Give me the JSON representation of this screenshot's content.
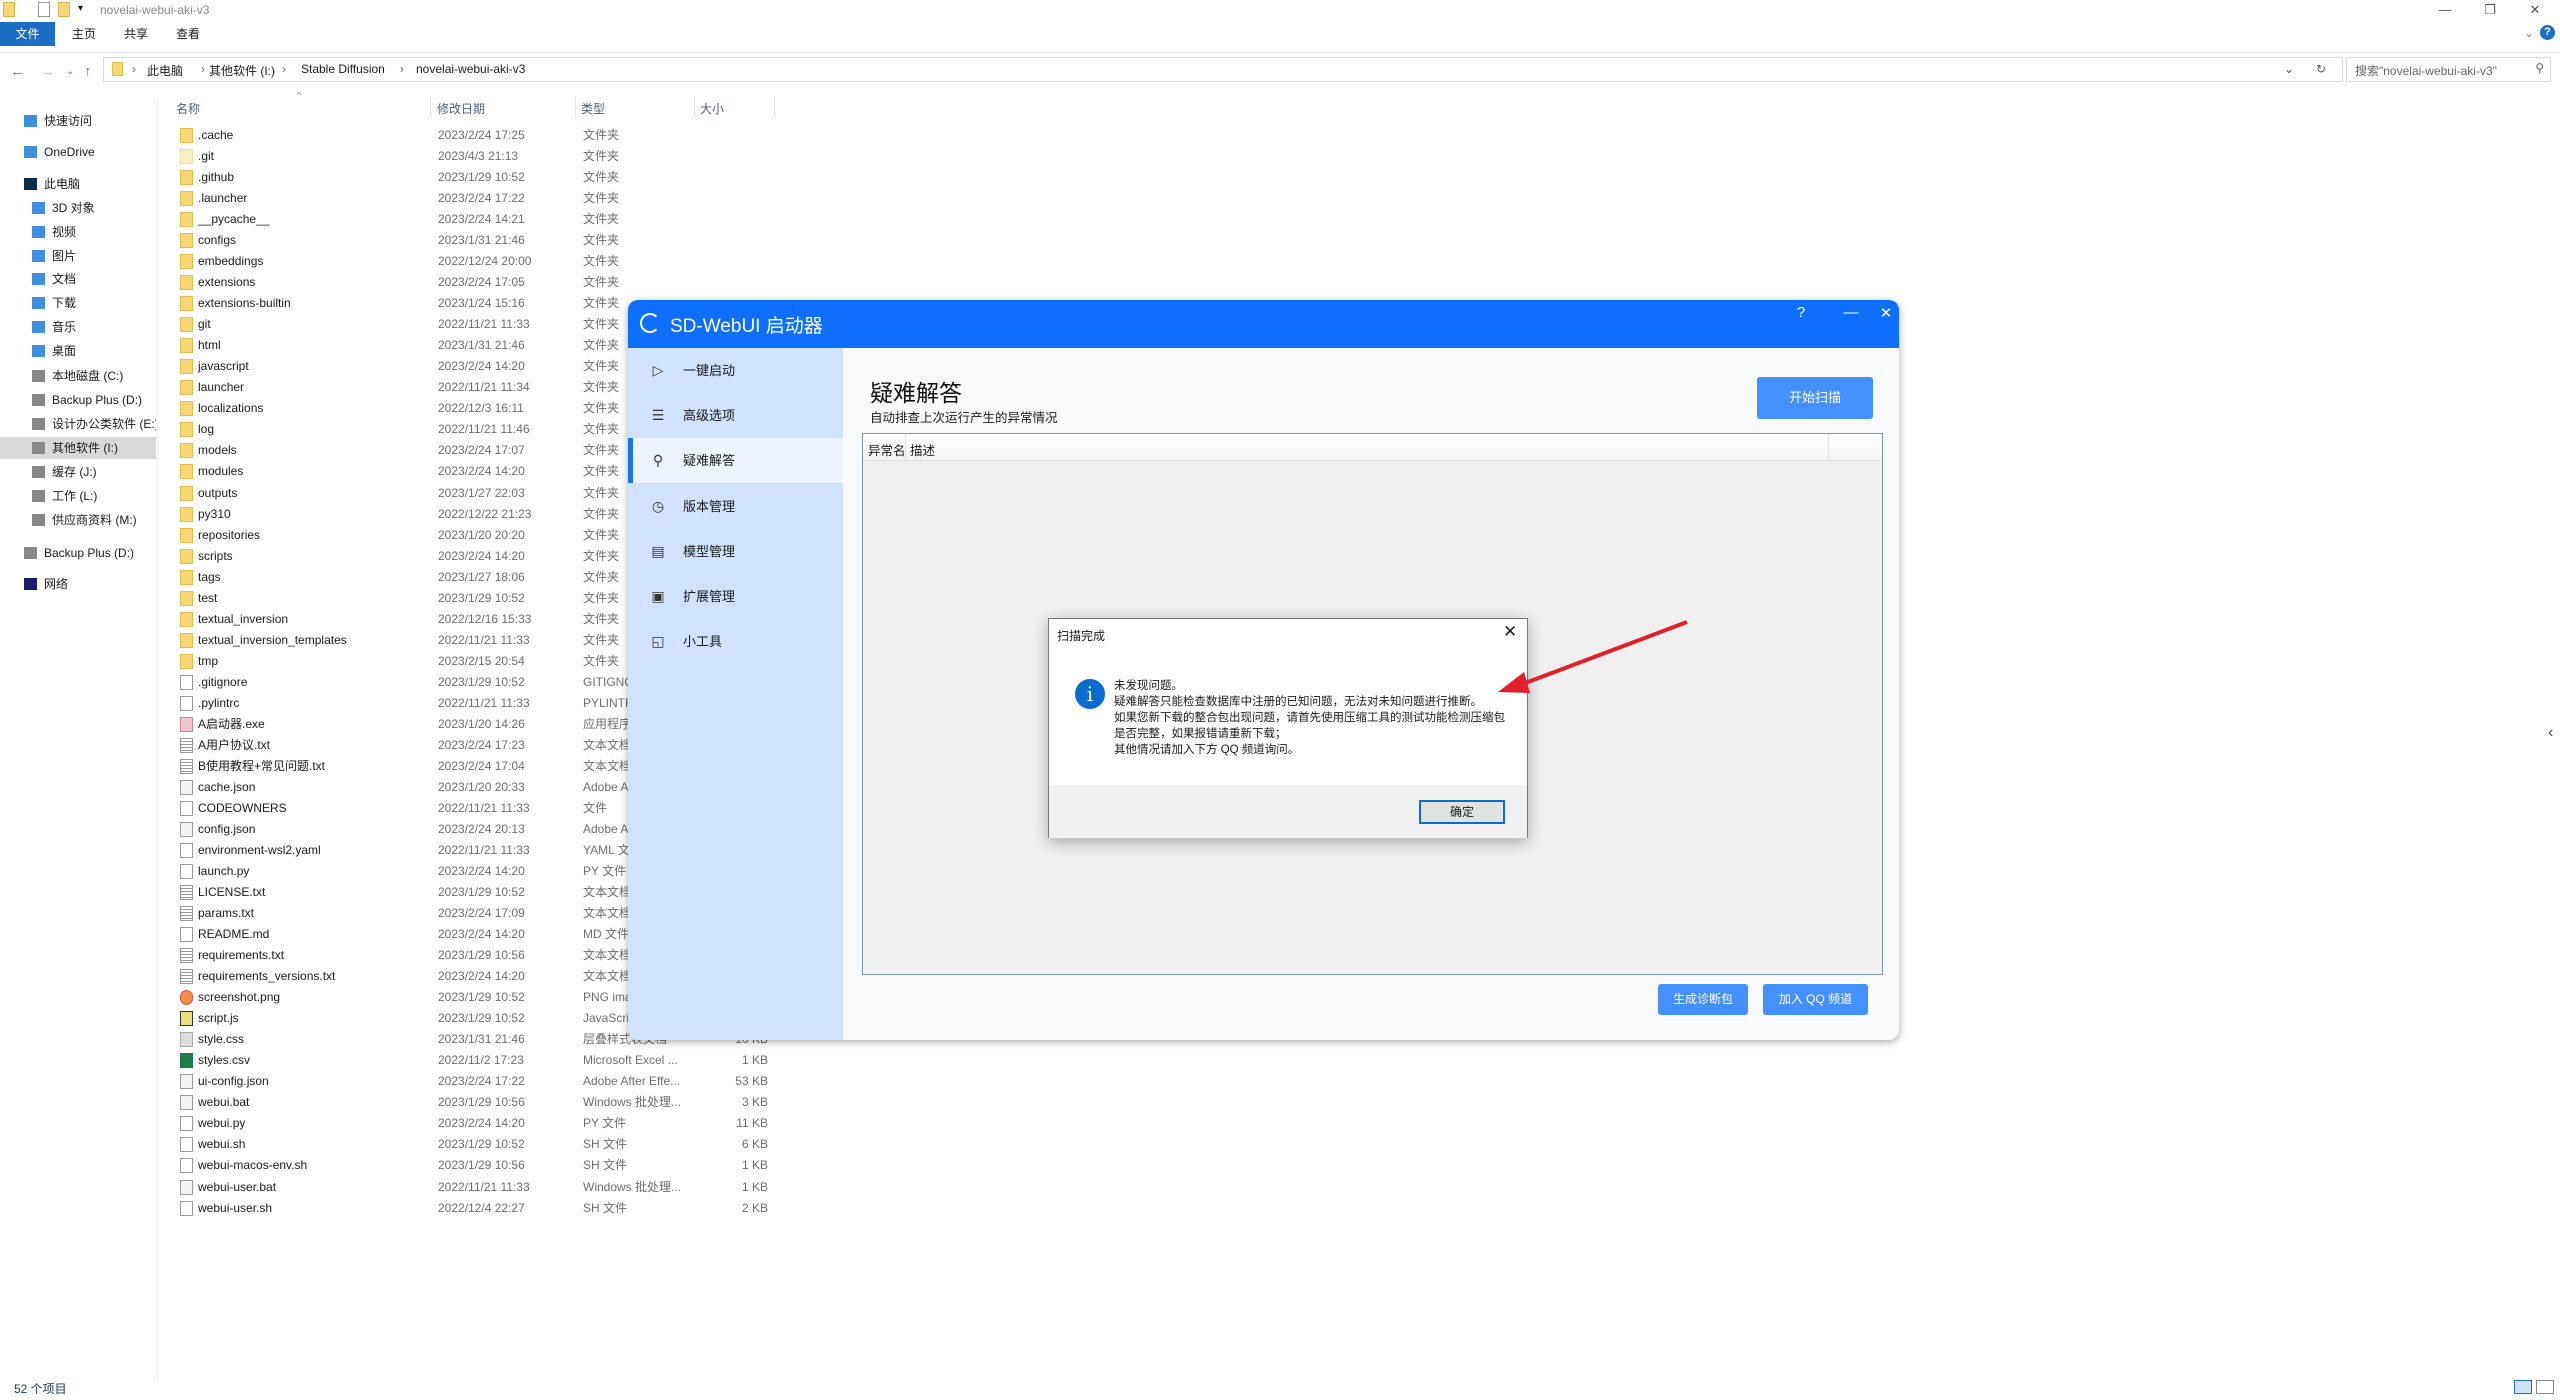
{
  "explorer": {
    "window_title": "novelai-webui-aki-v3",
    "ribbon_tabs": [
      "文件",
      "主页",
      "共享",
      "查看"
    ],
    "breadcrumb": [
      "此电脑",
      "其他软件 (I:)",
      "Stable Diffusion",
      "novelai-webui-aki-v3"
    ],
    "search_placeholder": "搜索\"novelai-webui-aki-v3\"",
    "nav": [
      {
        "label": "快速访问",
        "icon": "star-icon",
        "indent": 1
      },
      {
        "label": "OneDrive",
        "icon": "cloud-icon",
        "indent": 1
      },
      {
        "label": "此电脑",
        "icon": "computer-icon",
        "indent": 1
      },
      {
        "label": "3D 对象",
        "icon": "cube-icon",
        "indent": 2
      },
      {
        "label": "视频",
        "icon": "video-icon",
        "indent": 2
      },
      {
        "label": "图片",
        "icon": "picture-icon",
        "indent": 2
      },
      {
        "label": "文档",
        "icon": "document-icon",
        "indent": 2
      },
      {
        "label": "下载",
        "icon": "download-icon",
        "indent": 2
      },
      {
        "label": "音乐",
        "icon": "music-icon",
        "indent": 2
      },
      {
        "label": "桌面",
        "icon": "desktop-icon",
        "indent": 2
      },
      {
        "label": "本地磁盘 (C:)",
        "icon": "drive-icon",
        "indent": 2
      },
      {
        "label": "Backup Plus (D:)",
        "icon": "drive-icon",
        "indent": 2
      },
      {
        "label": "设计办公类软件 (E:)",
        "icon": "drive-icon",
        "indent": 2
      },
      {
        "label": "其他软件 (I:)",
        "icon": "drive-icon",
        "indent": 2,
        "selected": true
      },
      {
        "label": "缓存 (J:)",
        "icon": "drive-icon",
        "indent": 2
      },
      {
        "label": "工作 (L:)",
        "icon": "drive-icon",
        "indent": 2
      },
      {
        "label": "供应商资料 (M:)",
        "icon": "drive-icon",
        "indent": 2
      },
      {
        "label": "Backup Plus (D:)",
        "icon": "drive-icon",
        "indent": 1
      },
      {
        "label": "网络",
        "icon": "network-icon",
        "indent": 1
      }
    ],
    "columns": [
      "名称",
      "修改日期",
      "类型",
      "大小"
    ],
    "files": [
      {
        "name": ".cache",
        "date": "2023/2/24 17:25",
        "type": "文件夹",
        "size": "",
        "icon": "folder"
      },
      {
        "name": ".git",
        "date": "2023/4/3 21:13",
        "type": "文件夹",
        "size": "",
        "icon": "folder-faded"
      },
      {
        "name": ".github",
        "date": "2023/1/29 10:52",
        "type": "文件夹",
        "size": "",
        "icon": "folder"
      },
      {
        "name": ".launcher",
        "date": "2023/2/24 17:22",
        "type": "文件夹",
        "size": "",
        "icon": "folder"
      },
      {
        "name": "__pycache__",
        "date": "2023/2/24 14:21",
        "type": "文件夹",
        "size": "",
        "icon": "folder"
      },
      {
        "name": "configs",
        "date": "2023/1/31 21:46",
        "type": "文件夹",
        "size": "",
        "icon": "folder"
      },
      {
        "name": "embeddings",
        "date": "2022/12/24 20:00",
        "type": "文件夹",
        "size": "",
        "icon": "folder"
      },
      {
        "name": "extensions",
        "date": "2023/2/24 17:05",
        "type": "文件夹",
        "size": "",
        "icon": "folder"
      },
      {
        "name": "extensions-builtin",
        "date": "2023/1/24 15:16",
        "type": "文件夹",
        "size": "",
        "icon": "folder"
      },
      {
        "name": "git",
        "date": "2022/11/21 11:33",
        "type": "文件夹",
        "size": "",
        "icon": "folder"
      },
      {
        "name": "html",
        "date": "2023/1/31 21:46",
        "type": "文件夹",
        "size": "",
        "icon": "folder"
      },
      {
        "name": "javascript",
        "date": "2023/2/24 14:20",
        "type": "文件夹",
        "size": "",
        "icon": "folder"
      },
      {
        "name": "launcher",
        "date": "2022/11/21 11:34",
        "type": "文件夹",
        "size": "",
        "icon": "folder"
      },
      {
        "name": "localizations",
        "date": "2022/12/3 16:11",
        "type": "文件夹",
        "size": "",
        "icon": "folder"
      },
      {
        "name": "log",
        "date": "2022/11/21 11:46",
        "type": "文件夹",
        "size": "",
        "icon": "folder"
      },
      {
        "name": "models",
        "date": "2023/2/24 17:07",
        "type": "文件夹",
        "size": "",
        "icon": "folder"
      },
      {
        "name": "modules",
        "date": "2023/2/24 14:20",
        "type": "文件夹",
        "size": "",
        "icon": "folder"
      },
      {
        "name": "outputs",
        "date": "2023/1/27 22:03",
        "type": "文件夹",
        "size": "",
        "icon": "folder"
      },
      {
        "name": "py310",
        "date": "2022/12/22 21:23",
        "type": "文件夹",
        "size": "",
        "icon": "folder"
      },
      {
        "name": "repositories",
        "date": "2023/1/20 20:20",
        "type": "文件夹",
        "size": "",
        "icon": "folder"
      },
      {
        "name": "scripts",
        "date": "2023/2/24 14:20",
        "type": "文件夹",
        "size": "",
        "icon": "folder"
      },
      {
        "name": "tags",
        "date": "2023/1/27 18:06",
        "type": "文件夹",
        "size": "",
        "icon": "folder"
      },
      {
        "name": "test",
        "date": "2023/1/29 10:52",
        "type": "文件夹",
        "size": "",
        "icon": "folder"
      },
      {
        "name": "textual_inversion",
        "date": "2022/12/16 15:33",
        "type": "文件夹",
        "size": "",
        "icon": "folder"
      },
      {
        "name": "textual_inversion_templates",
        "date": "2022/11/21 11:33",
        "type": "文件夹",
        "size": "",
        "icon": "folder"
      },
      {
        "name": "tmp",
        "date": "2023/2/15 20:54",
        "type": "文件夹",
        "size": "",
        "icon": "folder"
      },
      {
        "name": ".gitignore",
        "date": "2023/1/29 10:52",
        "type": "GITIGNO",
        "size": "",
        "icon": "file"
      },
      {
        "name": ".pylintrc",
        "date": "2022/11/21 11:33",
        "type": "PYLINTR",
        "size": "",
        "icon": "file"
      },
      {
        "name": "A启动器.exe",
        "date": "2023/1/20 14:26",
        "type": "应用程序",
        "size": "",
        "icon": "exe"
      },
      {
        "name": "A用户协议.txt",
        "date": "2023/2/24 17:23",
        "type": "文本文档",
        "size": "",
        "icon": "text"
      },
      {
        "name": "B使用教程+常见问题.txt",
        "date": "2023/2/24 17:04",
        "type": "文本文档",
        "size": "",
        "icon": "text"
      },
      {
        "name": "cache.json",
        "date": "2023/1/20 20:33",
        "type": "Adobe A",
        "size": "",
        "icon": "json"
      },
      {
        "name": "CODEOWNERS",
        "date": "2022/11/21 11:33",
        "type": "文件",
        "size": "",
        "icon": "file"
      },
      {
        "name": "config.json",
        "date": "2023/2/24 20:13",
        "type": "Adobe A",
        "size": "",
        "icon": "json"
      },
      {
        "name": "environment-wsl2.yaml",
        "date": "2022/11/21 11:33",
        "type": "YAML 文",
        "size": "",
        "icon": "file"
      },
      {
        "name": "launch.py",
        "date": "2023/2/24 14:20",
        "type": "PY 文件",
        "size": "",
        "icon": "file"
      },
      {
        "name": "LICENSE.txt",
        "date": "2023/1/29 10:52",
        "type": "文本文档",
        "size": "",
        "icon": "text"
      },
      {
        "name": "params.txt",
        "date": "2023/2/24 17:09",
        "type": "文本文档",
        "size": "",
        "icon": "text"
      },
      {
        "name": "README.md",
        "date": "2023/2/24 14:20",
        "type": "MD 文件",
        "size": "",
        "icon": "file"
      },
      {
        "name": "requirements.txt",
        "date": "2023/1/29 10:56",
        "type": "文本文档",
        "size": "",
        "icon": "text"
      },
      {
        "name": "requirements_versions.txt",
        "date": "2023/2/24 14:20",
        "type": "文本文档",
        "size": "",
        "icon": "text"
      },
      {
        "name": "screenshot.png",
        "date": "2023/1/29 10:52",
        "type": "PNG ima",
        "size": "",
        "icon": "png"
      },
      {
        "name": "script.js",
        "date": "2023/1/29 10:52",
        "type": "JavaScri",
        "size": "",
        "icon": "js"
      },
      {
        "name": "style.css",
        "date": "2023/1/31 21:46",
        "type": "层叠样式表文档",
        "size": "10 KB",
        "icon": "css"
      },
      {
        "name": "styles.csv",
        "date": "2022/11/2 17:23",
        "type": "Microsoft Excel ...",
        "size": "1 KB",
        "icon": "excel"
      },
      {
        "name": "ui-config.json",
        "date": "2023/2/24 17:22",
        "type": "Adobe After Effe...",
        "size": "53 KB",
        "icon": "json"
      },
      {
        "name": "webui.bat",
        "date": "2023/1/29 10:56",
        "type": "Windows 批处理...",
        "size": "3 KB",
        "icon": "bat"
      },
      {
        "name": "webui.py",
        "date": "2023/2/24 14:20",
        "type": "PY 文件",
        "size": "11 KB",
        "icon": "file"
      },
      {
        "name": "webui.sh",
        "date": "2023/1/29 10:52",
        "type": "SH 文件",
        "size": "6 KB",
        "icon": "file"
      },
      {
        "name": "webui-macos-env.sh",
        "date": "2023/1/29 10:56",
        "type": "SH 文件",
        "size": "1 KB",
        "icon": "file"
      },
      {
        "name": "webui-user.bat",
        "date": "2022/11/21 11:33",
        "type": "Windows 批处理...",
        "size": "1 KB",
        "icon": "bat"
      },
      {
        "name": "webui-user.sh",
        "date": "2022/12/4 22:27",
        "type": "SH 文件",
        "size": "2 KB",
        "icon": "file"
      }
    ],
    "status": "52 个项目"
  },
  "launcher": {
    "title": "SD-WebUI 启动器",
    "header_buttons": [
      "?",
      "—",
      "✕"
    ],
    "sidebar": [
      {
        "label": "一键启动",
        "icon": "play-icon",
        "glyph": "▷"
      },
      {
        "label": "高级选项",
        "icon": "list-icon",
        "glyph": "☰"
      },
      {
        "label": "疑难解答",
        "icon": "wrench-icon",
        "glyph": "⚲",
        "active": true
      },
      {
        "label": "版本管理",
        "icon": "history-icon",
        "glyph": "◷"
      },
      {
        "label": "模型管理",
        "icon": "archive-icon",
        "glyph": "▤"
      },
      {
        "label": "扩展管理",
        "icon": "chip-icon",
        "glyph": "▣"
      },
      {
        "label": "小工具",
        "icon": "tools-icon",
        "glyph": "◱"
      }
    ],
    "footer_icons": [
      "globe-icon",
      "bilibili-icon",
      "qq-icon"
    ],
    "page_title": "疑难解答",
    "page_subtitle": "自动排查上次运行产生的异常情况",
    "scan_button": "开始扫描",
    "table_columns": [
      "异常名",
      "描述"
    ],
    "diag_button": "生成诊断包",
    "qq_button": "加入 QQ 频道",
    "accent": "#0e6ffc"
  },
  "dialog": {
    "title": "扫描完成",
    "lines": [
      "未发现问题。",
      "疑难解答只能检查数据库中注册的已知问题，无法对未知问题进行推断。",
      "如果您新下载的整合包出现问题，请首先使用压缩工具的测试功能检测压缩包",
      "是否完整，如果报错请重新下载；",
      "其他情况请加入下方 QQ 频道询问。"
    ],
    "ok": "确定",
    "icon": "info-icon"
  },
  "annotation": {
    "arrow_color": "#e0202a"
  }
}
